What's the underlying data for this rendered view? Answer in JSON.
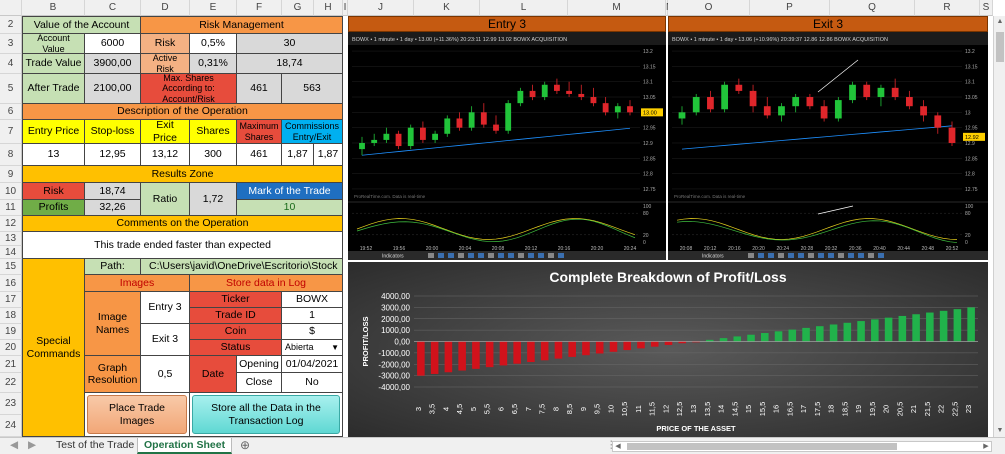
{
  "sheet": {
    "columns": [
      "A",
      "B",
      "C",
      "D",
      "E",
      "F",
      "G",
      "H",
      "I",
      "J",
      "K",
      "L",
      "M",
      "N",
      "O",
      "P",
      "Q",
      "R",
      "S"
    ],
    "rows": [
      "2",
      "3",
      "4",
      "5",
      "6",
      "7",
      "8",
      "9",
      "10",
      "11",
      "12",
      "13",
      "14",
      "15",
      "16",
      "17",
      "18",
      "19",
      "20",
      "21",
      "22",
      "23",
      "24"
    ]
  },
  "account": {
    "title": "Value of the Account",
    "account_value_label": "Account Value",
    "account_value": "6000",
    "trade_value_label": "Trade Value",
    "trade_value": "3900,00",
    "after_trade_label": "After Trade",
    "after_trade": "2100,00"
  },
  "risk": {
    "title": "Risk Management",
    "risk_label": "Risk",
    "risk_value": "0,5%",
    "risk_amount": "30",
    "active_risk_label": "Active Risk",
    "active_risk_value": "0,31%",
    "active_risk_amount": "18,74",
    "max_shares_label": "Max. Shares According to: Account/Risk",
    "max_shares_account": "461",
    "max_shares_risk": "563"
  },
  "operation": {
    "title": "Description of the Operation",
    "headers": [
      "Entry Price",
      "Stop-loss",
      "Exit Price",
      "Shares",
      "Maximum Shares",
      "Commissions Entry/Exit"
    ],
    "values": [
      "13",
      "12,95",
      "13,12",
      "300",
      "461",
      "1,87",
      "1,87"
    ]
  },
  "results": {
    "title": "Results Zone",
    "risk_label": "Risk",
    "risk_value": "18,74",
    "profits_label": "Profits",
    "profits_value": "32,26",
    "ratio_label": "Ratio",
    "ratio_value": "1,72",
    "mark_label": "Mark of the Trade",
    "mark_value": "10"
  },
  "comments": {
    "title": "Comments on the Operation",
    "text": "This trade ended faster than expected"
  },
  "special": {
    "label": "Special Commands",
    "path_label": "Path:",
    "path_value": "C:\\Users\\javid\\OneDrive\\Escritorio\\Stock",
    "images_label": "Images",
    "image_names_label": "Image Names",
    "entry_name": "Entry 3",
    "exit_name": "Exit 3",
    "graph_res_label": "Graph Resolution",
    "graph_res_value": "0,5",
    "store_label": "Store data in Log",
    "ticker_label": "Ticker",
    "ticker_value": "BOWX",
    "trade_id_label": "Trade ID",
    "trade_id_value": "1",
    "coin_label": "Coin",
    "coin_value": "$",
    "status_label": "Status",
    "status_value": "Abierta",
    "date_label": "Date",
    "opening_label": "Opening",
    "opening_value": "01/04/2021",
    "close_label": "Close",
    "close_value": "No",
    "place_images_button": "Place Trade Images",
    "store_all_button": "Store all the Data in the Transaction Log"
  },
  "entry_chart": {
    "title": "Entry 3",
    "toolbar_text": "BOWX  • 1 minute • 1 day •   13.00 (+11.36%) 20:23:11  12.99 13.02 BOWX ACQUISITION",
    "date_label": "Thu 01 Apr 2021",
    "watermark": "ProRealTime.com. Data is real-time",
    "indicators_label": "Indicators",
    "price_ticks": [
      "13.2",
      "13.15",
      "13.1",
      "13.05",
      "13",
      "12.95",
      "12.9",
      "12.85",
      "12.8",
      "12.75"
    ],
    "time_ticks": [
      "19:52",
      "19:56",
      "20:00",
      "20:04",
      "20:08",
      "20:12",
      "20:16",
      "20:20",
      "20:24"
    ],
    "osc_ticks": [
      "100",
      "80",
      "20",
      "0"
    ],
    "last_price": "13.00",
    "candles": [
      [
        12.88,
        12.92,
        12.86,
        12.9
      ],
      [
        12.9,
        12.93,
        12.89,
        12.91
      ],
      [
        12.91,
        12.95,
        12.9,
        12.93
      ],
      [
        12.93,
        12.94,
        12.88,
        12.89
      ],
      [
        12.89,
        12.96,
        12.88,
        12.95
      ],
      [
        12.95,
        12.97,
        12.9,
        12.91
      ],
      [
        12.91,
        12.94,
        12.9,
        12.93
      ],
      [
        12.93,
        12.99,
        12.92,
        12.98
      ],
      [
        12.98,
        13.0,
        12.94,
        12.95
      ],
      [
        12.95,
        13.02,
        12.94,
        13.0
      ],
      [
        13.0,
        13.03,
        12.95,
        12.96
      ],
      [
        12.96,
        12.99,
        12.93,
        12.94
      ],
      [
        12.94,
        13.04,
        12.93,
        13.03
      ],
      [
        13.03,
        13.08,
        13.02,
        13.07
      ],
      [
        13.07,
        13.09,
        13.04,
        13.05
      ],
      [
        13.05,
        13.1,
        13.04,
        13.09
      ],
      [
        13.09,
        13.11,
        13.06,
        13.07
      ],
      [
        13.07,
        13.1,
        13.05,
        13.06
      ],
      [
        13.06,
        13.09,
        13.04,
        13.05
      ],
      [
        13.05,
        13.08,
        13.02,
        13.03
      ],
      [
        13.03,
        13.05,
        12.99,
        13.0
      ],
      [
        13.0,
        13.03,
        12.98,
        13.02
      ],
      [
        13.02,
        13.04,
        12.99,
        13.0
      ]
    ]
  },
  "exit_chart": {
    "title": "Exit 3",
    "toolbar_text": "BOWX  • 1 minute • 1 day •   13.06 (+10.96%) 20:39:37  12.86 12.86 BOWX ACQUISITION",
    "date_label": "Thu 01 Apr 2021",
    "watermark": "ProRealTime.com. Data is real-time",
    "indicators_label": "Indicators",
    "price_ticks": [
      "13.2",
      "13.15",
      "13.1",
      "13.05",
      "13",
      "12.95",
      "12.9",
      "12.85",
      "12.8",
      "12.75"
    ],
    "time_ticks": [
      "20:08",
      "20:12",
      "20:16",
      "20:20",
      "20:24",
      "20:28",
      "20:32",
      "20:36",
      "20:40",
      "20:44",
      "20:48",
      "20:52"
    ],
    "osc_ticks": [
      "100",
      "80",
      "20",
      "0"
    ],
    "last_price": "12.92",
    "candles": [
      [
        12.98,
        13.02,
        12.96,
        13.0
      ],
      [
        13.0,
        13.06,
        12.99,
        13.05
      ],
      [
        13.05,
        13.07,
        13.0,
        13.01
      ],
      [
        13.01,
        13.1,
        13.0,
        13.09
      ],
      [
        13.09,
        13.11,
        13.06,
        13.07
      ],
      [
        13.07,
        13.09,
        13.0,
        13.02
      ],
      [
        13.02,
        13.05,
        12.98,
        12.99
      ],
      [
        12.99,
        13.03,
        12.97,
        13.02
      ],
      [
        13.02,
        13.06,
        13.0,
        13.05
      ],
      [
        13.05,
        13.06,
        13.01,
        13.02
      ],
      [
        13.02,
        13.04,
        12.97,
        12.98
      ],
      [
        12.98,
        13.05,
        12.97,
        13.04
      ],
      [
        13.04,
        13.1,
        13.03,
        13.09
      ],
      [
        13.09,
        13.1,
        13.04,
        13.05
      ],
      [
        13.05,
        13.09,
        13.02,
        13.08
      ],
      [
        13.08,
        13.11,
        13.04,
        13.05
      ],
      [
        13.05,
        13.07,
        13.01,
        13.02
      ],
      [
        13.02,
        13.04,
        12.97,
        12.99
      ],
      [
        12.99,
        13.0,
        12.93,
        12.95
      ],
      [
        12.95,
        12.97,
        12.89,
        12.9
      ]
    ]
  },
  "chart_data": {
    "type": "bar",
    "title": "Complete Breakdown of Profit/Loss",
    "xlabel": "PRICE OF THE ASSET",
    "ylabel": "PROFIT/LOSS",
    "ylim": [
      -4000,
      4000
    ],
    "yticks": [
      "4000,00",
      "3000,00",
      "2000,00",
      "1000,00",
      "0,00",
      "-1000,00",
      "-2000,00",
      "-3000,00",
      "-4000,00"
    ],
    "categories": [
      "3",
      "3,5",
      "4",
      "4,5",
      "5",
      "5,5",
      "6",
      "6,5",
      "7",
      "7,5",
      "8",
      "8,5",
      "9",
      "9,5",
      "10",
      "10,5",
      "11",
      "11,5",
      "12",
      "12,5",
      "13",
      "13,5",
      "14",
      "14,5",
      "15",
      "15,5",
      "16",
      "16,5",
      "17",
      "17,5",
      "18",
      "18,5",
      "19",
      "19,5",
      "20",
      "20,5",
      "21",
      "21,5",
      "22",
      "22,5",
      "23"
    ],
    "values": [
      -3004,
      -2854,
      -2704,
      -2554,
      -2404,
      -2254,
      -2104,
      -1954,
      -1804,
      -1654,
      -1504,
      -1354,
      -1204,
      -1054,
      -904,
      -754,
      -604,
      -454,
      -304,
      -154,
      -4,
      146,
      296,
      446,
      596,
      746,
      896,
      1046,
      1196,
      1346,
      1496,
      1646,
      1796,
      1946,
      2096,
      2246,
      2396,
      2546,
      2696,
      2846,
      2996
    ]
  }
}
